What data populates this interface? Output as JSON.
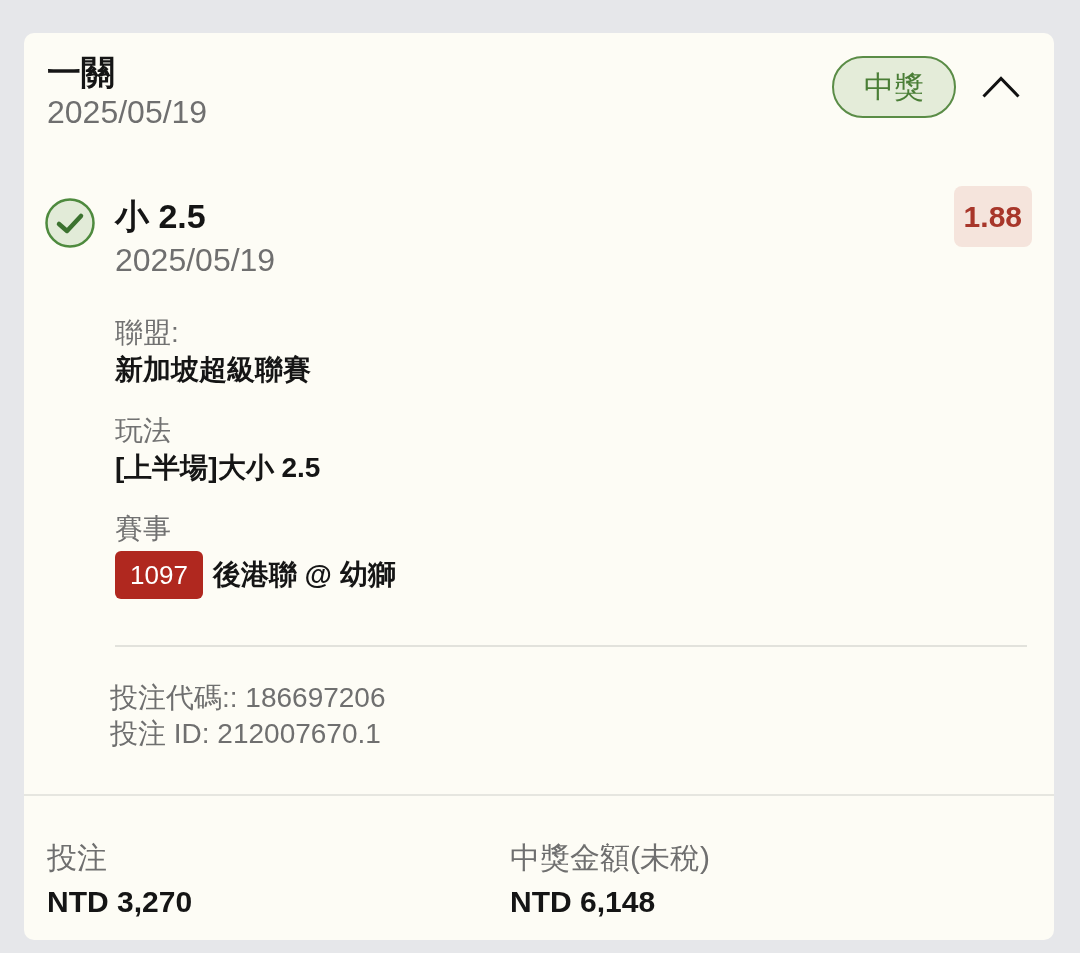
{
  "bet": {
    "type": "一關",
    "date": "2025/05/19",
    "status": {
      "label": "中獎",
      "kind": "won"
    },
    "expanded": true
  },
  "selections": [
    {
      "name": "小 2.5",
      "date": "2025/05/19",
      "won": true,
      "odds": "1.88",
      "details": [
        {
          "label": "聯盟:",
          "value": "新加坡超級聯賽"
        },
        {
          "label": "玩法",
          "value": "[上半場]大小 2.5"
        },
        {
          "label": "賽事",
          "match_number": "1097",
          "value": "後港聯 @ 幼獅"
        }
      ],
      "codes": [
        "投注代碼:: 186697206",
        "投注 ID: 212007670.1"
      ]
    }
  ],
  "summary": [
    {
      "label": "投注",
      "value": "NTD 3,270"
    },
    {
      "label": "中獎金額(未稅)",
      "value": "NTD 6,148"
    }
  ]
}
